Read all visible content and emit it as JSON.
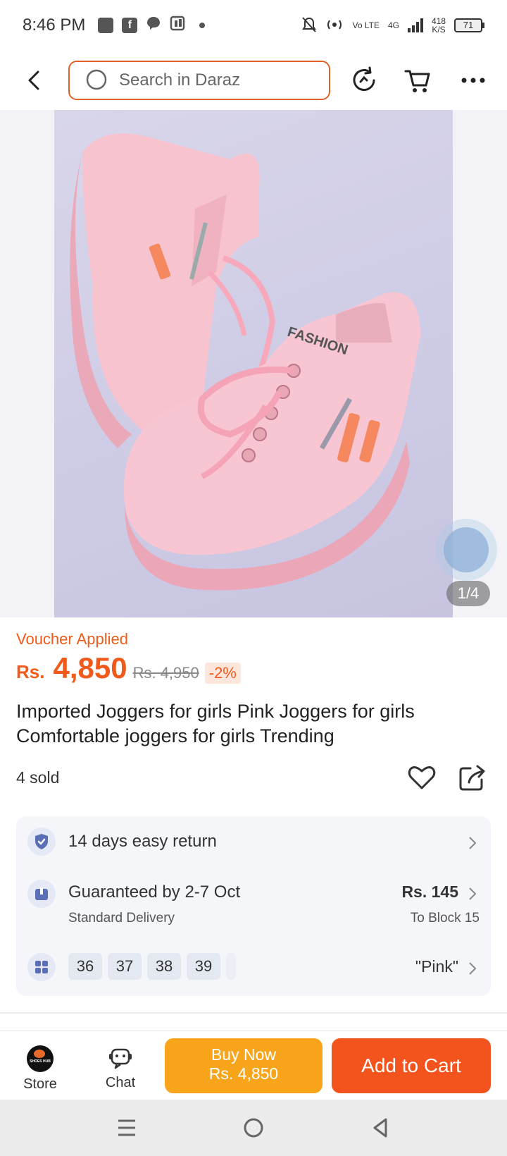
{
  "status_bar": {
    "time": "8:46 PM",
    "volte": "Vo LTE",
    "network": "4G",
    "speed_value": "418",
    "speed_unit": "K/S",
    "battery": "71"
  },
  "header": {
    "search_placeholder": "Search in Daraz"
  },
  "gallery": {
    "counter": "1/4"
  },
  "product": {
    "voucher_label": "Voucher Applied",
    "price_currency": "Rs.",
    "price": "4,850",
    "original_price": "Rs. 4,950",
    "discount": "-2%",
    "title": "Imported Joggers for girls Pink Joggers for girls Comfortable joggers for girls Trending",
    "sold": "4 sold"
  },
  "info": {
    "return_text": "14 days easy return",
    "delivery_title": "Guaranteed by 2-7 Oct",
    "delivery_sub": "Standard Delivery",
    "delivery_fee": "Rs. 145",
    "delivery_to": "To Block 15",
    "sizes": [
      "36",
      "37",
      "38",
      "39"
    ],
    "color": "\"Pink\""
  },
  "bottom_bar": {
    "store_label": "Store",
    "store_logo_text": "SHOES HUB",
    "chat_label": "Chat",
    "buy_now_label": "Buy Now",
    "buy_now_price": "Rs. 4,850",
    "add_to_cart_label": "Add to Cart"
  },
  "colors": {
    "accent": "#f05a1a",
    "buy_now": "#f9a51b",
    "add_to_cart": "#f3531c",
    "product_pink": "#f4c4cf"
  }
}
